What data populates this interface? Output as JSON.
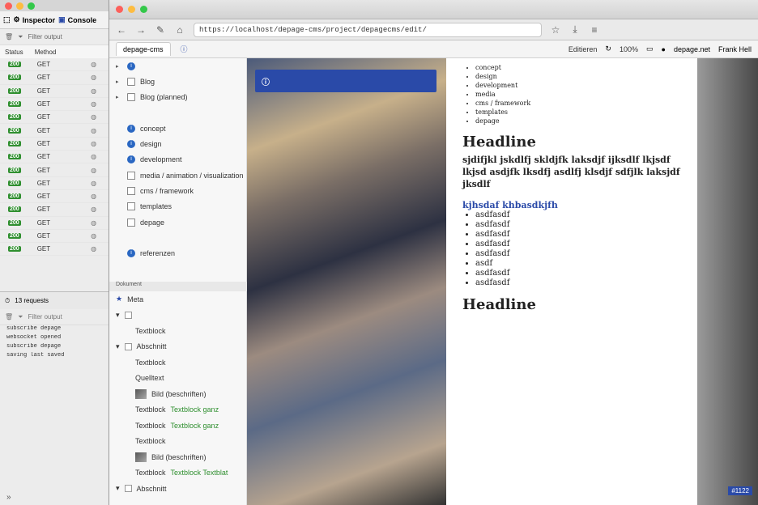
{
  "devtools": {
    "tabs": [
      {
        "label": "Inspector"
      },
      {
        "label": "Console"
      }
    ],
    "filter_placeholder": "Filter output",
    "columns": [
      "Status",
      "Method"
    ],
    "requests": [
      {
        "status": "200",
        "method": "GET"
      },
      {
        "status": "200",
        "method": "GET"
      },
      {
        "status": "200",
        "method": "GET"
      },
      {
        "status": "200",
        "method": "GET"
      },
      {
        "status": "200",
        "method": "GET"
      },
      {
        "status": "200",
        "method": "GET"
      },
      {
        "status": "200",
        "method": "GET"
      },
      {
        "status": "200",
        "method": "GET"
      },
      {
        "status": "200",
        "method": "GET"
      },
      {
        "status": "200",
        "method": "GET"
      },
      {
        "status": "200",
        "method": "GET"
      },
      {
        "status": "200",
        "method": "GET"
      },
      {
        "status": "200",
        "method": "GET"
      },
      {
        "status": "200",
        "method": "GET"
      },
      {
        "status": "200",
        "method": "GET"
      }
    ],
    "console_requests_label": "13 requests",
    "console_filter": "Filter output",
    "log_lines": [
      "subscribe depage",
      "websocket opened",
      "subscribe depage",
      "saving last saved",
      "",
      "",
      "",
      "",
      "",
      "",
      "",
      "",
      "",
      "",
      "",
      ""
    ],
    "expand": "»"
  },
  "browser": {
    "url": "https://localhost/depage-cms/project/depagecms/edit/",
    "tab_label": "depage-cms",
    "edit_label": "Editieren",
    "zoom_label": "100%",
    "right_user": "depage.net",
    "right_user2": "Frank Hell"
  },
  "tree": {
    "items": [
      {
        "label": "",
        "icon": "info",
        "arrow": "▸"
      },
      {
        "label": "Blog",
        "icon": "folder",
        "arrow": "▸"
      },
      {
        "label": "Blog (planned)",
        "icon": "folder",
        "arrow": "▸"
      },
      {
        "label": "",
        "icon": "none",
        "arrow": ""
      },
      {
        "label": "concept",
        "icon": "info",
        "arrow": ""
      },
      {
        "label": "design",
        "icon": "info",
        "arrow": ""
      },
      {
        "label": "development",
        "icon": "info",
        "arrow": ""
      },
      {
        "label": "media / animation / visualization",
        "icon": "page",
        "arrow": ""
      },
      {
        "label": "cms / framework",
        "icon": "page",
        "arrow": ""
      },
      {
        "label": "templates",
        "icon": "page",
        "arrow": ""
      },
      {
        "label": "depage",
        "icon": "page",
        "arrow": ""
      },
      {
        "label": "",
        "icon": "none",
        "arrow": ""
      },
      {
        "label": "referenzen",
        "icon": "info",
        "arrow": ""
      }
    ],
    "doc_bar": "Dokument",
    "doc_items": [
      {
        "label": "Meta",
        "kind": "star",
        "indent": false,
        "green": ""
      },
      {
        "label": "",
        "kind": "arrow",
        "indent": false,
        "green": ""
      },
      {
        "label": "Textblock",
        "kind": "none",
        "indent": true,
        "green": ""
      },
      {
        "label": "Abschnitt",
        "kind": "arrow",
        "indent": false,
        "green": ""
      },
      {
        "label": "Textblock",
        "kind": "none",
        "indent": true,
        "green": ""
      },
      {
        "label": "Quelltext",
        "kind": "none",
        "indent": true,
        "green": ""
      },
      {
        "label": "Bild (beschriften)",
        "kind": "thumb",
        "indent": true,
        "green": ""
      },
      {
        "label": "Textblock",
        "kind": "none",
        "indent": true,
        "green": "Textblock ganz"
      },
      {
        "label": "Textblock",
        "kind": "none",
        "indent": true,
        "green": "Textblock ganz"
      },
      {
        "label": "Textblock",
        "kind": "none",
        "indent": true,
        "green": ""
      },
      {
        "label": "Bild (beschriften)",
        "kind": "thumb",
        "indent": true,
        "green": ""
      },
      {
        "label": "Textblock",
        "kind": "none",
        "indent": true,
        "green": "Textblock Textblat"
      },
      {
        "label": "Abschnitt",
        "kind": "arrow",
        "indent": false,
        "green": ""
      }
    ]
  },
  "doc": {
    "headline1": "Headline",
    "para1": "sjdifjkl jskdlfj skldjfk laksdjf ijksdlf lkjsdf lkjsd asdjfk lksdfj asdlfj klsdjf sdfjlk laksjdf jksdlf",
    "subhead": "kjhsdaf khbasdkjfh",
    "bullets": [
      "asdfasdf",
      "asdfasdf",
      "asdfasdf",
      "asdfasdf",
      "asdfasdf",
      "asdf",
      "asdfasdf",
      "asdfasdf"
    ],
    "headline2": "Headline",
    "menu_items": [
      "concept",
      "design",
      "development",
      "media",
      "cms / framework",
      "templates",
      "depage"
    ],
    "status": "#1122"
  },
  "colors": {
    "accent": "#2a4aa8",
    "status_ok": "#2f8f2f"
  }
}
